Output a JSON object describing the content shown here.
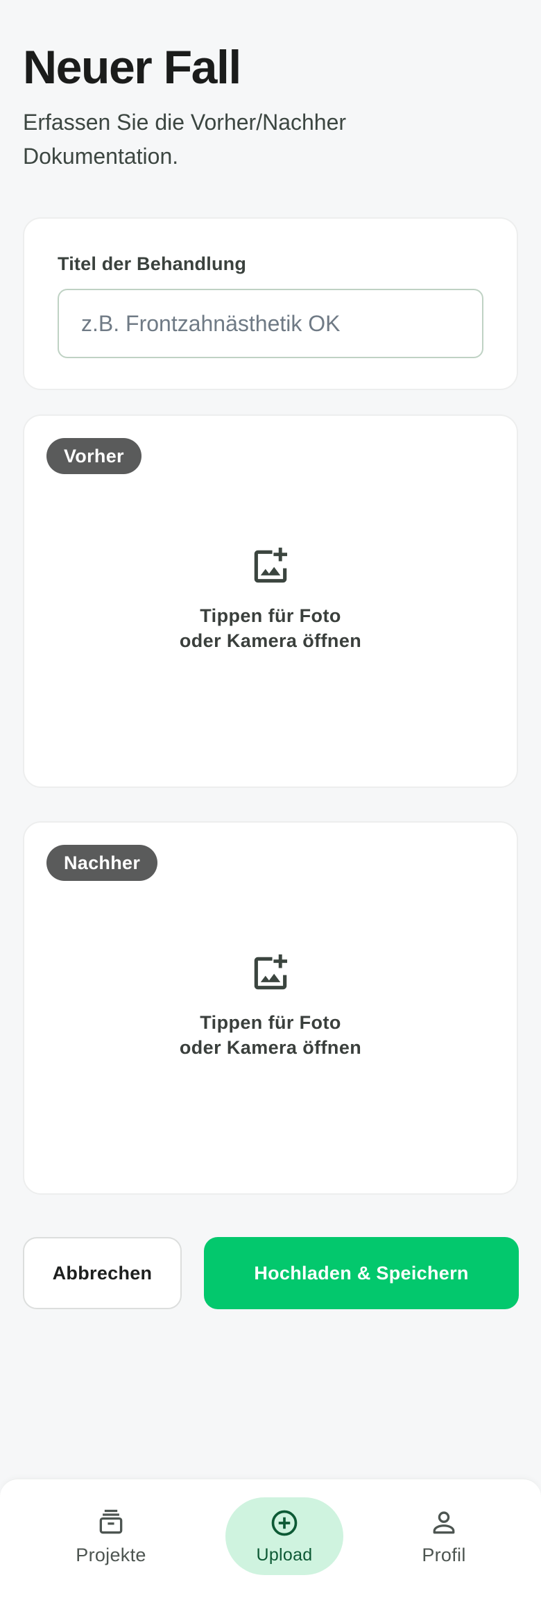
{
  "header": {
    "title": "Neuer Fall",
    "subtitle": "Erfassen Sie die Vorher/Nachher Dokumentation."
  },
  "title_card": {
    "label": "Titel der Behandlung",
    "input_value": "",
    "placeholder": "z.B. Frontzahnästhetik OK"
  },
  "before_card": {
    "badge": "Vorher",
    "icon": "add-photo-icon",
    "hint_line1": "Tippen für Foto",
    "hint_line2": "oder Kamera öffnen"
  },
  "after_card": {
    "badge": "Nachher",
    "icon": "add-photo-icon",
    "hint_line1": "Tippen für Foto",
    "hint_line2": "oder Kamera öffnen"
  },
  "actions": {
    "cancel_label": "Abbrechen",
    "save_label": "Hochladen & Speichern"
  },
  "bottom_nav": {
    "items": [
      {
        "label": "Projekte",
        "icon": "archive-icon",
        "active": false
      },
      {
        "label": "Upload",
        "icon": "add-circle-icon",
        "active": true
      },
      {
        "label": "Profil",
        "icon": "person-icon",
        "active": false
      }
    ]
  },
  "colors": {
    "accent": "#03c86d",
    "active_nav_bg": "#cff3df",
    "badge_bg": "#5a5b5b",
    "background": "#f6f7f8"
  }
}
